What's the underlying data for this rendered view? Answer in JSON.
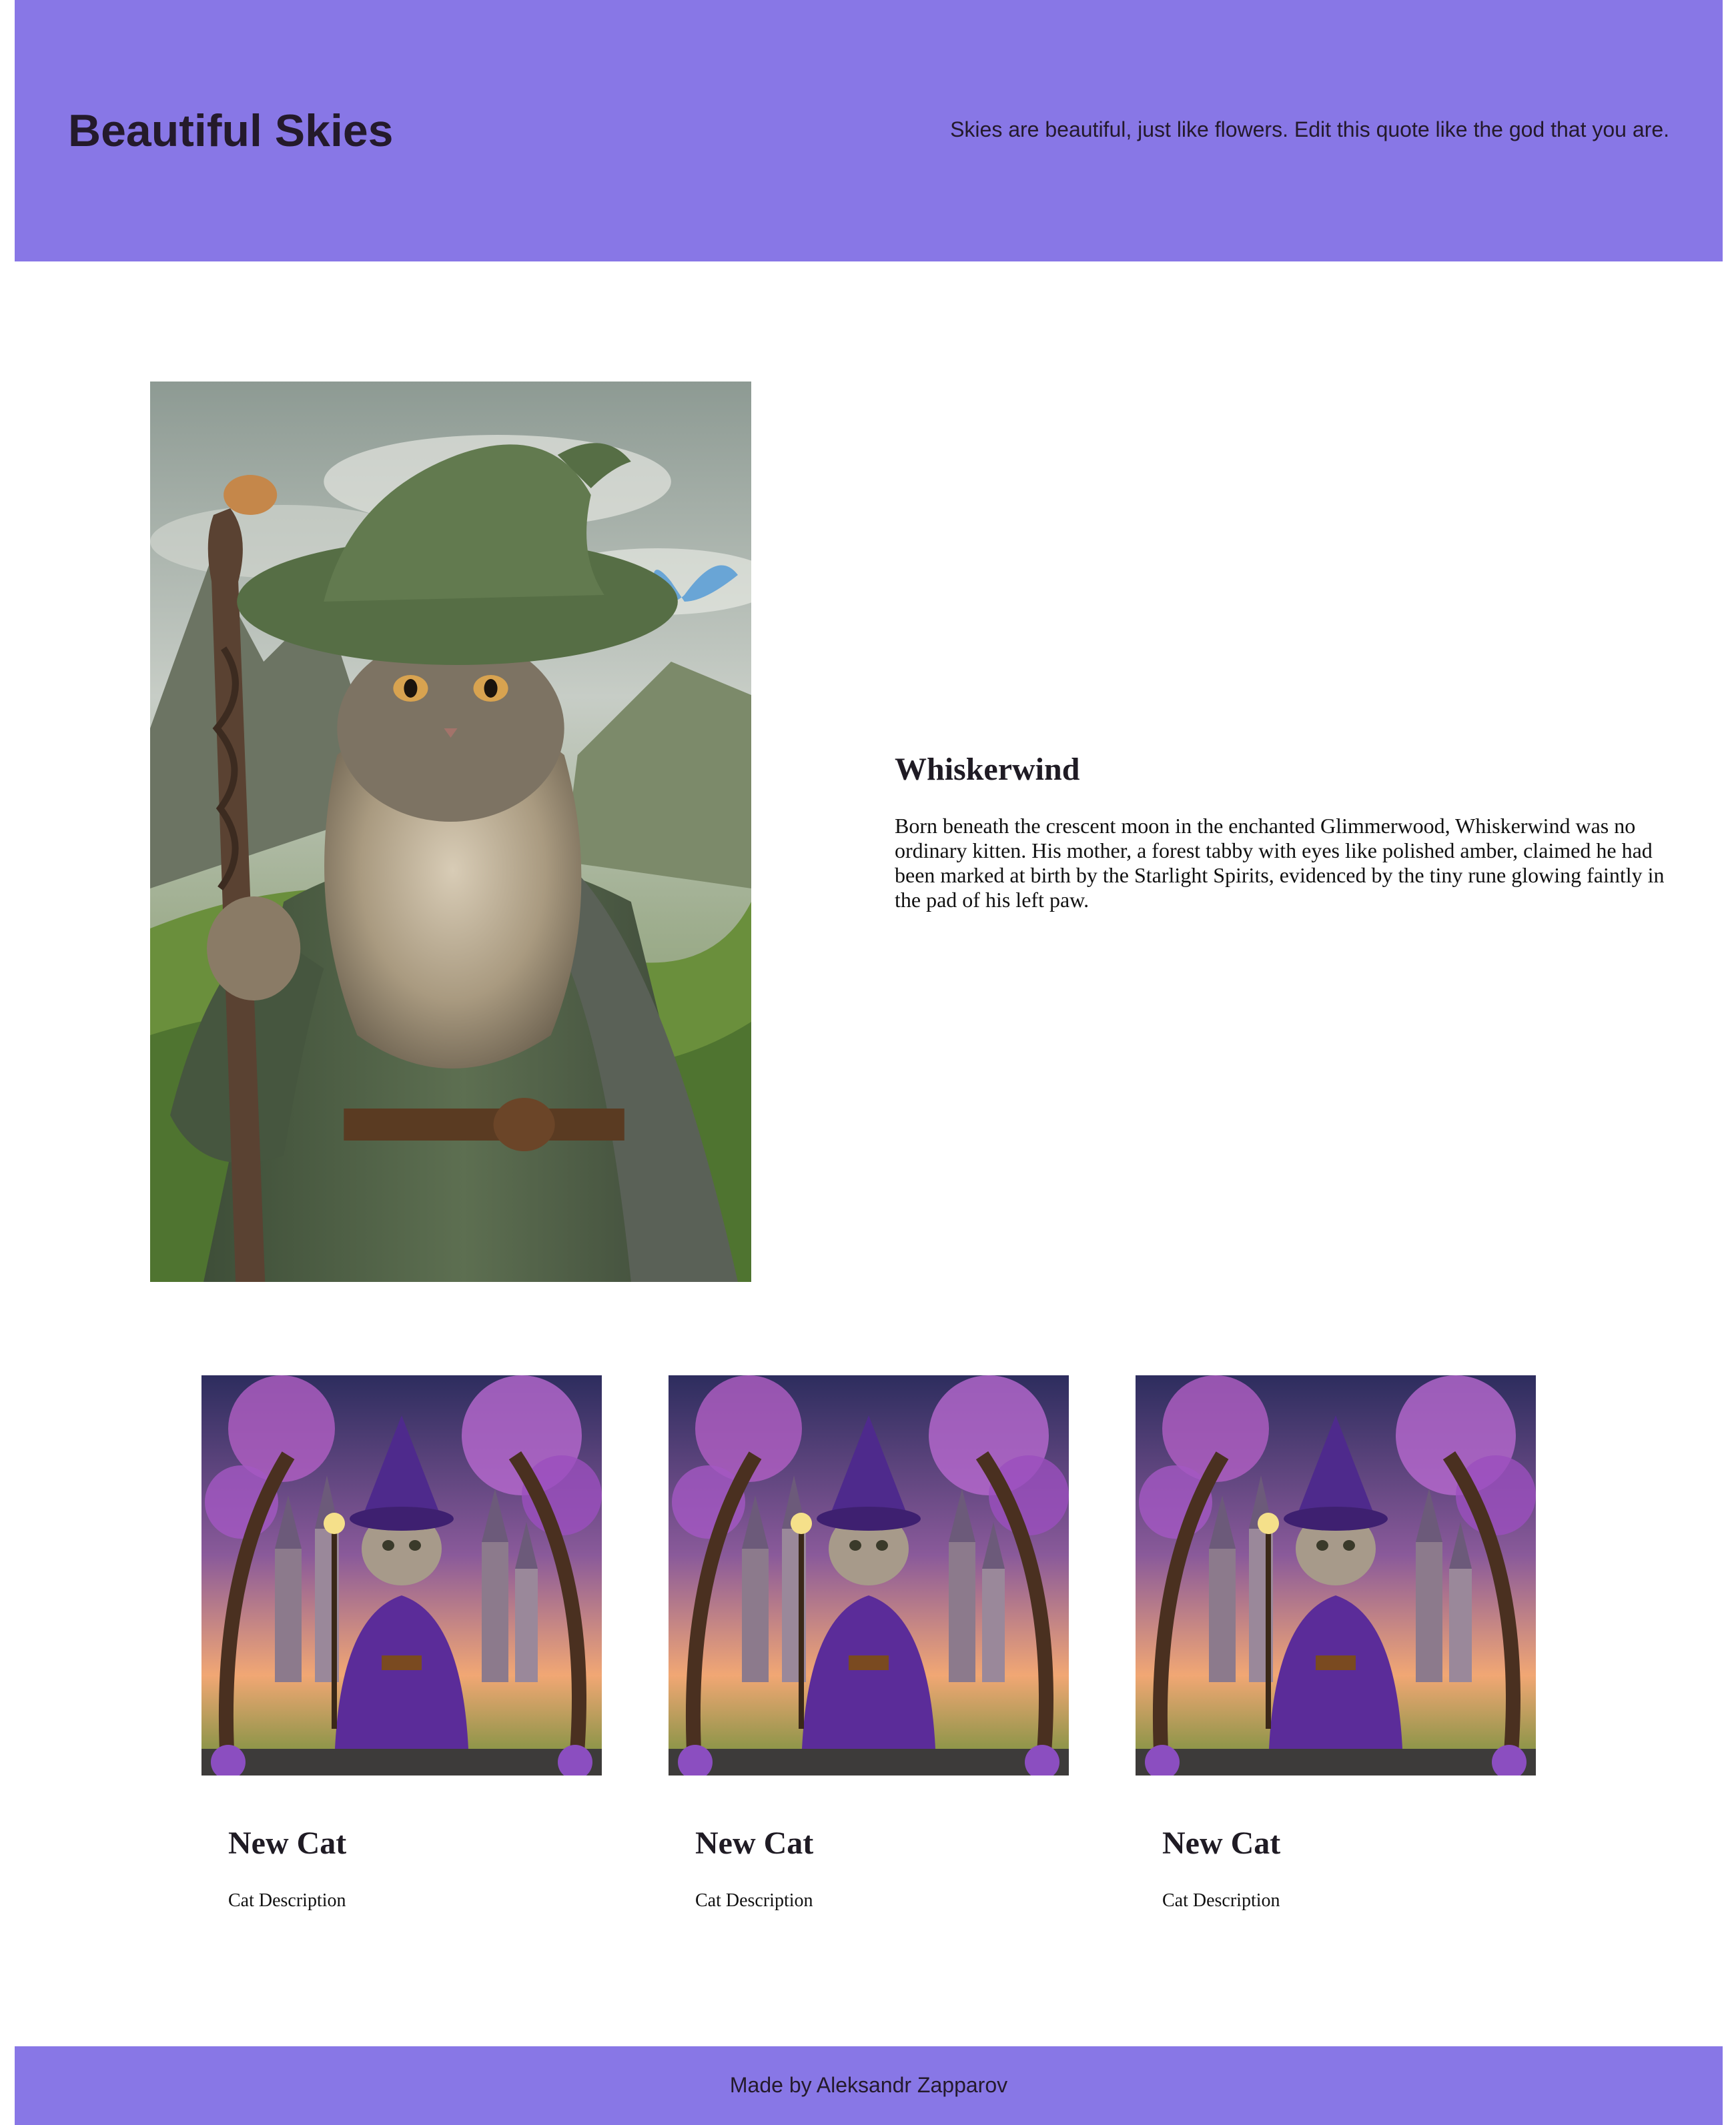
{
  "header": {
    "title": "Beautiful Skies",
    "quote": "Skies are beautiful, just like flowers. Edit this quote like the god that you are."
  },
  "feature": {
    "name": "Whiskerwind",
    "description": "Born beneath the crescent moon in the enchanted Glimmerwood, Whiskerwind was no ordinary kitten. His mother, a forest tabby with eyes like polished amber, claimed he had been marked at birth by the Starlight Spirits, evidenced by the tiny rune glowing faintly in the pad of his left paw."
  },
  "cards": [
    {
      "title": "New Cat",
      "description": "Cat Description"
    },
    {
      "title": "New Cat",
      "description": "Cat Description"
    },
    {
      "title": "New Cat",
      "description": "Cat Description"
    }
  ],
  "footer": {
    "text": "Made by Aleksandr Zapparov"
  },
  "colors": {
    "header_bg": "#8877e6",
    "footer_bg": "#8877e6",
    "text_dark": "#241a2b"
  }
}
